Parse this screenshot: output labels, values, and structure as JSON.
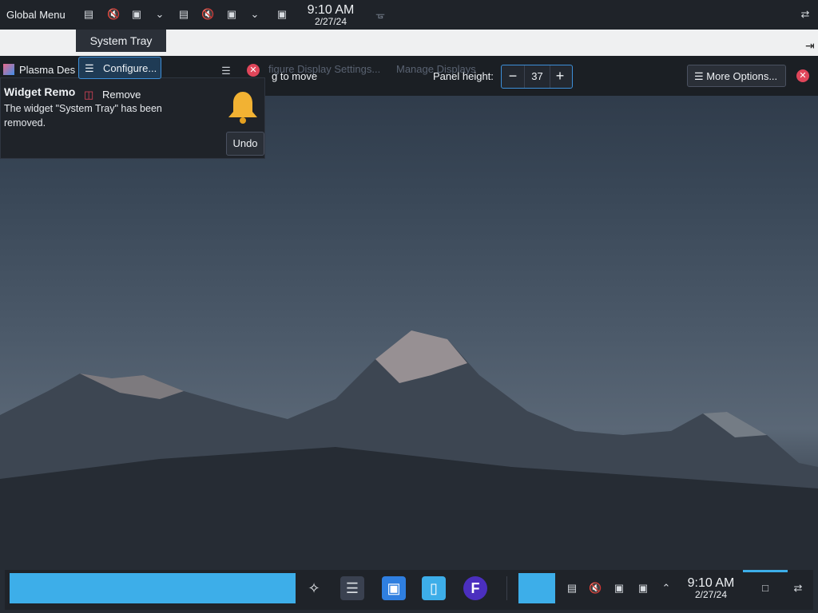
{
  "top_panel": {
    "global_menu_label": "Global Menu",
    "clock_time": "9:10 AM",
    "clock_date": "2/27/24"
  },
  "toolbar": {
    "window_title": "Plasma Des",
    "hint_text": "g to move",
    "faded_config_label": "figure Display Settings...",
    "faded_manage_label": "Manage Displays",
    "panel_height_label": "Panel height:",
    "panel_height_value": "37",
    "more_options_label": "More Options..."
  },
  "tray_menu": {
    "header": "System Tray",
    "configure_label": "Configure...",
    "remove_label": "Remove"
  },
  "notification": {
    "title": "Widget Remo",
    "body": "The widget \"System Tray\" has been removed.",
    "undo_label": "Undo"
  },
  "bottom_panel": {
    "clock_time": "9:10 AM",
    "clock_date": "2/27/24"
  },
  "colors": {
    "accent": "#3daee9",
    "panel_bg": "#1f2329",
    "close_red": "#e0465a"
  }
}
